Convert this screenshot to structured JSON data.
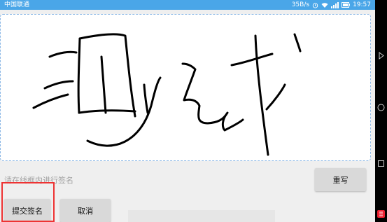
{
  "status_bar": {
    "carrier": "中国联通",
    "network_speed": "35B/s",
    "time": "19:57"
  },
  "signature_pad": {
    "hint": "请在线框内进行签名",
    "border_color": "#8cb8e6",
    "stroke_color": "#000000"
  },
  "buttons": {
    "rewrite": "重写",
    "submit": "提交签名",
    "cancel": "取消"
  },
  "highlight_color": "#e33333"
}
